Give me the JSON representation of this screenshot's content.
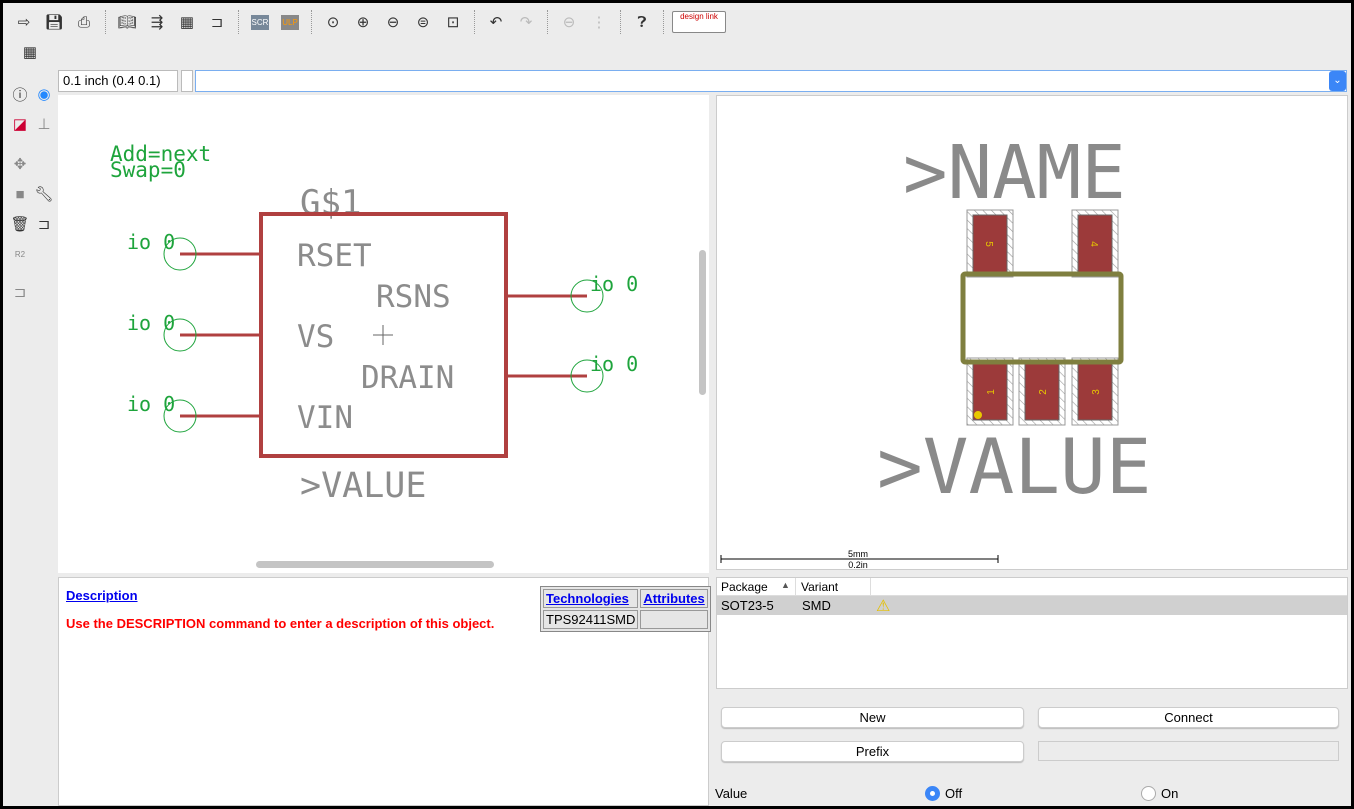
{
  "toolbar": {
    "icons": [
      "open-icon",
      "save-icon",
      "print-icon",
      "library-icon",
      "pin-swap-icon",
      "ic-icon",
      "gate-icon",
      "script-icon",
      "ulp-icon",
      "zoom-fit-icon",
      "zoom-in-icon",
      "zoom-out-icon",
      "zoom-redraw-icon",
      "zoom-select-icon",
      "undo-icon",
      "redo-icon",
      "stop-icon",
      "go-icon",
      "help-icon"
    ],
    "scr_label": "SCR",
    "ulp_label": "ULP",
    "designlink_label": "design link"
  },
  "grid_label": "0.1 inch (0.4 0.1)",
  "command_value": "",
  "schematic": {
    "add_text": "Add=next",
    "swap_text": "Swap=0",
    "gate_name": "G$1",
    "value_text": ">VALUE",
    "pins": [
      "RSET",
      "RSNS",
      "VS",
      "DRAIN",
      "VIN"
    ],
    "pin_io_label": "io 0",
    "frame_color": "#b04040",
    "text_color": "#1ea43c"
  },
  "footprint": {
    "name_text": ">NAME",
    "value_text": ">VALUE",
    "pads": [
      "1",
      "2",
      "3",
      "4",
      "5"
    ],
    "scale_mm": "5mm",
    "scale_in": "0.2in"
  },
  "description": {
    "title": "Description",
    "message": "Use the DESCRIPTION command to enter a description of this object."
  },
  "technologies": {
    "headers": [
      "Technologies",
      "Attributes"
    ],
    "rows": [
      [
        "TPS92411SMD",
        ""
      ]
    ]
  },
  "packages": {
    "headers": [
      "Package",
      "Variant"
    ],
    "rows": [
      {
        "package": "SOT23-5",
        "variant": "SMD",
        "warning": true
      }
    ]
  },
  "buttons": {
    "new": "New",
    "connect": "Connect",
    "prefix": "Prefix",
    "prefix_value": ""
  },
  "value_option": {
    "label": "Value",
    "off": "Off",
    "on": "On",
    "selected": "Off"
  }
}
